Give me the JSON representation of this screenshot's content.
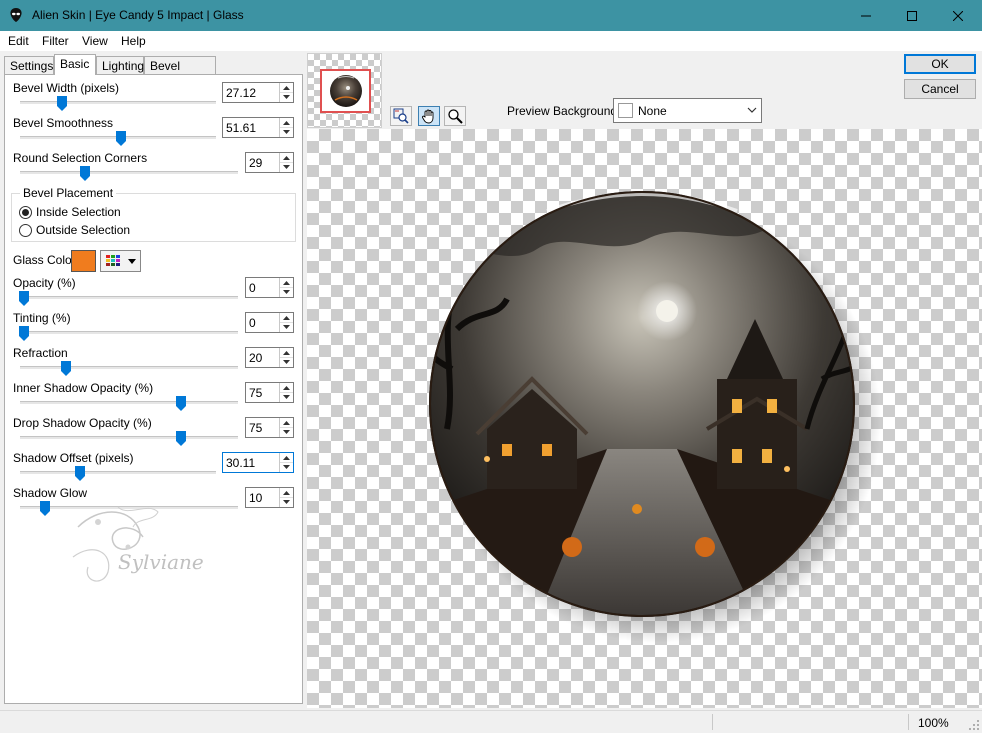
{
  "window": {
    "title": "Alien Skin | Eye Candy 5 Impact | Glass",
    "titlebar_color": "#3d93a3"
  },
  "menu": [
    {
      "label": "Edit"
    },
    {
      "label": "Filter"
    },
    {
      "label": "View"
    },
    {
      "label": "Help"
    }
  ],
  "tabs": [
    {
      "label": "Settings"
    },
    {
      "label": "Basic",
      "active": true
    },
    {
      "label": "Lighting"
    },
    {
      "label": "Bevel Profile"
    }
  ],
  "controls": {
    "bevel_width": {
      "label": "Bevel Width (pixels)",
      "value": "27.12"
    },
    "bevel_smoothness": {
      "label": "Bevel Smoothness",
      "value": "51.61"
    },
    "round_corners": {
      "label": "Round Selection Corners",
      "value": "29"
    },
    "opacity": {
      "label": "Opacity (%)",
      "value": "0"
    },
    "tinting": {
      "label": "Tinting (%)",
      "value": "0"
    },
    "refraction": {
      "label": "Refraction",
      "value": "20"
    },
    "inner_shadow": {
      "label": "Inner Shadow Opacity (%)",
      "value": "75"
    },
    "drop_shadow": {
      "label": "Drop Shadow Opacity (%)",
      "value": "75"
    },
    "shadow_offset": {
      "label": "Shadow Offset (pixels)",
      "value": "30.11"
    },
    "shadow_glow": {
      "label": "Shadow Glow",
      "value": "10"
    }
  },
  "bevel_placement": {
    "legend": "Bevel Placement",
    "options": [
      {
        "label": "Inside Selection",
        "checked": true
      },
      {
        "label": "Outside Selection",
        "checked": false
      }
    ]
  },
  "glass_color": {
    "label": "Glass Color",
    "color": "#f07c1e"
  },
  "preview": {
    "background_label": "Preview Background:",
    "background_value": "None",
    "zoom": "100%"
  },
  "buttons": {
    "ok": "OK",
    "cancel": "Cancel"
  },
  "watermark": {
    "text": "Sylviane"
  },
  "accent_color": "#0078d7"
}
